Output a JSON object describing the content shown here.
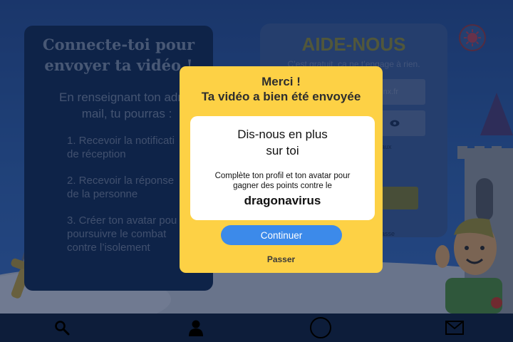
{
  "left_panel": {
    "title": "Connecte-toi pour\nenvoyer  ta vidéo !",
    "intro": "En renseignant ton adres\nmail, tu pourras :",
    "items": [
      "1. Recevoir la notificati\nde réception",
      "2. Recevoir la réponse\nde la personne",
      "3. Créer ton avatar pou\npoursuivre le combat\n contre l’isolement"
    ]
  },
  "right_panel": {
    "title": "AIDE-NOUS",
    "subtitle": "C’est gratuit, ca ne t’engage à rien.",
    "email_fragment": "nx.fr",
    "checkbox_fragment": "aux",
    "link_fragment": "asse"
  },
  "modal": {
    "title_line1": "Merci !",
    "title_line2": "Ta vidéo a bien été envoyée",
    "card_title": "Dis-nous en plus\nsur toi",
    "card_text": "Complète ton profil et ton avatar pour\ngagner des points  contre le",
    "card_strong": "dragonavirus",
    "continue_label": "Continuer",
    "skip_label": "Passer"
  },
  "bottom_nav": {
    "items": [
      "search-icon",
      "profile-icon",
      "home-circle-icon",
      "mail-icon"
    ]
  },
  "colors": {
    "modal_bg": "#fdd145",
    "accent_blue": "#3c8aea",
    "panel_dark": "#122c56"
  }
}
